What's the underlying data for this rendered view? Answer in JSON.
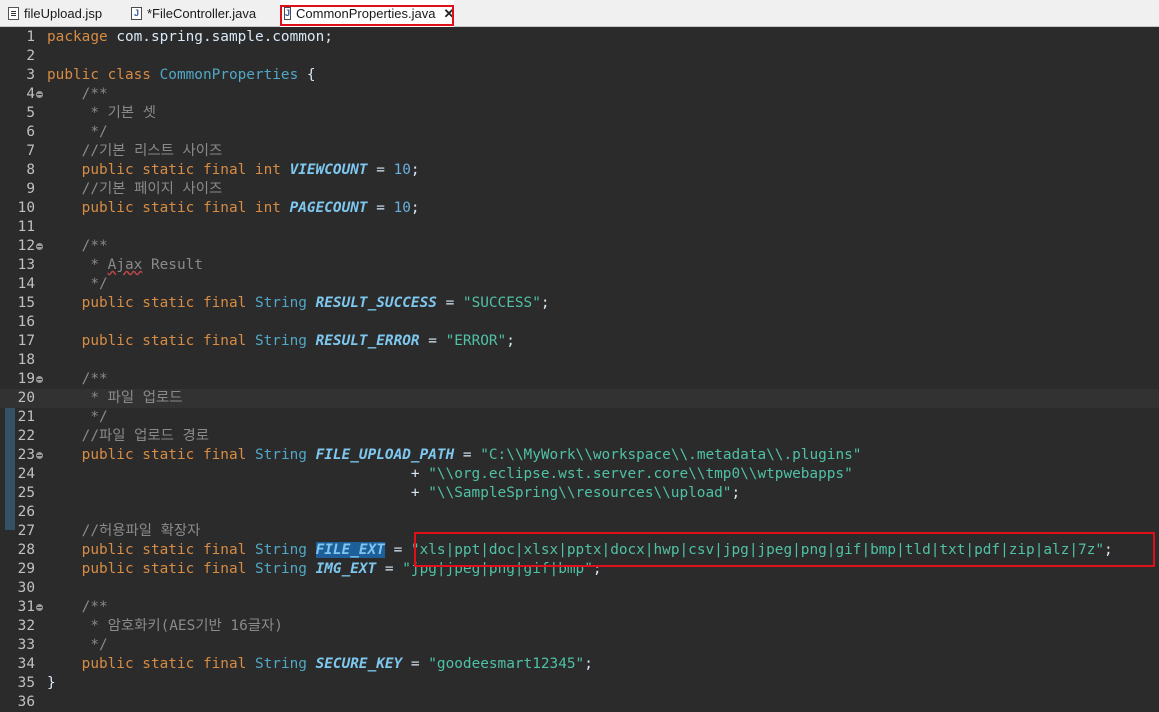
{
  "tabs": [
    {
      "label": "fileUpload.jsp",
      "icon": "jsp-file-icon",
      "active": false
    },
    {
      "label": "*FileController.java",
      "icon": "java-file-icon",
      "active": false
    },
    {
      "label": "CommonProperties.java",
      "icon": "java-file-icon",
      "active": true,
      "close": "✕"
    }
  ],
  "java_icon_glyph": "J",
  "colors": {
    "background": "#2b2b2b",
    "keyword": "#d68c45",
    "type": "#50a8c6",
    "constant": "#7ec7ef",
    "string": "#4fc1a5",
    "number": "#6ab0de",
    "comment": "#8a8a8a",
    "highlight_box": "#e0101a"
  },
  "code": {
    "line_numbers": [
      "1",
      "2",
      "3",
      "4",
      "5",
      "6",
      "7",
      "8",
      "9",
      "10",
      "11",
      "12",
      "13",
      "14",
      "15",
      "16",
      "17",
      "18",
      "19",
      "20",
      "21",
      "22",
      "23",
      "24",
      "25",
      "26",
      "27",
      "28",
      "29",
      "30",
      "31",
      "32",
      "33",
      "34",
      "35",
      "36"
    ],
    "l1": {
      "kw": "package",
      "rest": " com.spring.sample.common;"
    },
    "l3": {
      "kw": "public class",
      "name": "CommonProperties",
      "brace": " {"
    },
    "l4": "/**",
    "l5": " * 기본 셋",
    "l6": " */",
    "l7": "//기본 리스트 사이즈",
    "l8": {
      "mods": "public static final int",
      "name": "VIEWCOUNT",
      "op": " = ",
      "value": "10",
      "end": ";"
    },
    "l9": "//기본 페이지 사이즈",
    "l10": {
      "mods": "public static final int",
      "name": "PAGECOUNT",
      "op": " = ",
      "value": "10",
      "end": ";"
    },
    "l12": "/**",
    "l13": {
      "prefix": " * ",
      "word": "Ajax",
      "suffix": " Result"
    },
    "l14": " */",
    "l15": {
      "mods": "public static final",
      "type": "String",
      "name": "RESULT_SUCCESS",
      "op": " = ",
      "value": "\"SUCCESS\"",
      "end": ";"
    },
    "l17": {
      "mods": "public static final",
      "type": "String",
      "name": "RESULT_ERROR",
      "op": " = ",
      "value": "\"ERROR\"",
      "end": ";"
    },
    "l19": "/**",
    "l20": " * 파일 업로드",
    "l21": " */",
    "l22": "//파일 업로드 경로",
    "l23": {
      "mods": "public static final",
      "type": "String",
      "name": "FILE_UPLOAD_PATH",
      "op": " = ",
      "value": "\"C:\\\\MyWork\\\\workspace\\\\.metadata\\\\.plugins\""
    },
    "l24": {
      "op": "+ ",
      "value": "\"\\\\org.eclipse.wst.server.core\\\\tmp0\\\\wtpwebapps\""
    },
    "l25": {
      "op": "+ ",
      "value": "\"\\\\SampleSpring\\\\resources\\\\upload\"",
      "end": ";"
    },
    "l27": "//허용파일 확장자",
    "l28": {
      "mods": "public static final",
      "type": "String",
      "name": "FILE_EXT",
      "op": " = ",
      "value": "\"xls|ppt|doc|xlsx|pptx|docx|hwp|csv|jpg|jpeg|png|gif|bmp|tld|txt|pdf|zip|alz|7z\"",
      "end": ";"
    },
    "l29": {
      "mods": "public static final",
      "type": "String",
      "name": "IMG_EXT",
      "op": " = ",
      "value": "\"jpg|jpeg|png|gif|bmp\"",
      "end": ";"
    },
    "l31": "/**",
    "l32": " * 암호화키(AES기반 16글자)",
    "l33": " */",
    "l34": {
      "mods": "public static final",
      "type": "String",
      "name": "SECURE_KEY",
      "op": " = ",
      "value": "\"goodeesmart12345\"",
      "end": ";"
    },
    "l35": "}"
  }
}
